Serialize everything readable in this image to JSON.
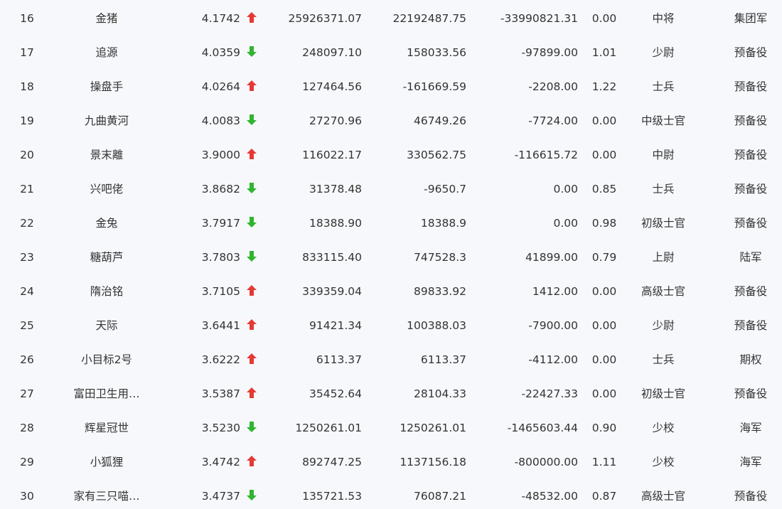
{
  "colors": {
    "up": "#e53935",
    "down": "#2fb52f"
  },
  "rows": [
    {
      "rank": "16",
      "name": "金猪",
      "score": "4.1742",
      "trend": "up",
      "v1": "25926371.07",
      "v2": "22192487.75",
      "v3": "-33990821.31",
      "ratio": "0.00",
      "rank_title": "中将",
      "branch": "集团军"
    },
    {
      "rank": "17",
      "name": "追源",
      "score": "4.0359",
      "trend": "down",
      "v1": "248097.10",
      "v2": "158033.56",
      "v3": "-97899.00",
      "ratio": "1.01",
      "rank_title": "少尉",
      "branch": "预备役"
    },
    {
      "rank": "18",
      "name": "操盘手",
      "score": "4.0264",
      "trend": "up",
      "v1": "127464.56",
      "v2": "-161669.59",
      "v3": "-2208.00",
      "ratio": "1.22",
      "rank_title": "士兵",
      "branch": "预备役"
    },
    {
      "rank": "19",
      "name": "九曲黄河",
      "score": "4.0083",
      "trend": "down",
      "v1": "27270.96",
      "v2": "46749.26",
      "v3": "-7724.00",
      "ratio": "0.00",
      "rank_title": "中级士官",
      "branch": "预备役"
    },
    {
      "rank": "20",
      "name": "景末離",
      "score": "3.9000",
      "trend": "up",
      "v1": "116022.17",
      "v2": "330562.75",
      "v3": "-116615.72",
      "ratio": "0.00",
      "rank_title": "中尉",
      "branch": "预备役"
    },
    {
      "rank": "21",
      "name": "兴吧佬",
      "score": "3.8682",
      "trend": "down",
      "v1": "31378.48",
      "v2": "-9650.7",
      "v3": "0.00",
      "ratio": "0.85",
      "rank_title": "士兵",
      "branch": "预备役"
    },
    {
      "rank": "22",
      "name": "金兔",
      "score": "3.7917",
      "trend": "down",
      "v1": "18388.90",
      "v2": "18388.9",
      "v3": "0.00",
      "ratio": "0.98",
      "rank_title": "初级士官",
      "branch": "预备役"
    },
    {
      "rank": "23",
      "name": "糖葫芦",
      "score": "3.7803",
      "trend": "down",
      "v1": "833115.40",
      "v2": "747528.3",
      "v3": "41899.00",
      "ratio": "0.79",
      "rank_title": "上尉",
      "branch": "陆军"
    },
    {
      "rank": "24",
      "name": "隋治铭",
      "score": "3.7105",
      "trend": "up",
      "v1": "339359.04",
      "v2": "89833.92",
      "v3": "1412.00",
      "ratio": "0.00",
      "rank_title": "高级士官",
      "branch": "预备役"
    },
    {
      "rank": "25",
      "name": "天际",
      "score": "3.6441",
      "trend": "up",
      "v1": "91421.34",
      "v2": "100388.03",
      "v3": "-7900.00",
      "ratio": "0.00",
      "rank_title": "少尉",
      "branch": "预备役"
    },
    {
      "rank": "26",
      "name": "小目标2号",
      "score": "3.6222",
      "trend": "up",
      "v1": "6113.37",
      "v2": "6113.37",
      "v3": "-4112.00",
      "ratio": "0.00",
      "rank_title": "士兵",
      "branch": "期权"
    },
    {
      "rank": "27",
      "name": "富田卫生用…",
      "score": "3.5387",
      "trend": "up",
      "v1": "35452.64",
      "v2": "28104.33",
      "v3": "-22427.33",
      "ratio": "0.00",
      "rank_title": "初级士官",
      "branch": "预备役"
    },
    {
      "rank": "28",
      "name": "辉星冠世",
      "score": "3.5230",
      "trend": "down",
      "v1": "1250261.01",
      "v2": "1250261.01",
      "v3": "-1465603.44",
      "ratio": "0.90",
      "rank_title": "少校",
      "branch": "海军"
    },
    {
      "rank": "29",
      "name": "小狐狸",
      "score": "3.4742",
      "trend": "up",
      "v1": "892747.25",
      "v2": "1137156.18",
      "v3": "-800000.00",
      "ratio": "1.11",
      "rank_title": "少校",
      "branch": "海军"
    },
    {
      "rank": "30",
      "name": "家有三只喵…",
      "score": "3.4737",
      "trend": "down",
      "v1": "135721.53",
      "v2": "76087.21",
      "v3": "-48532.00",
      "ratio": "0.87",
      "rank_title": "高级士官",
      "branch": "预备役"
    }
  ]
}
